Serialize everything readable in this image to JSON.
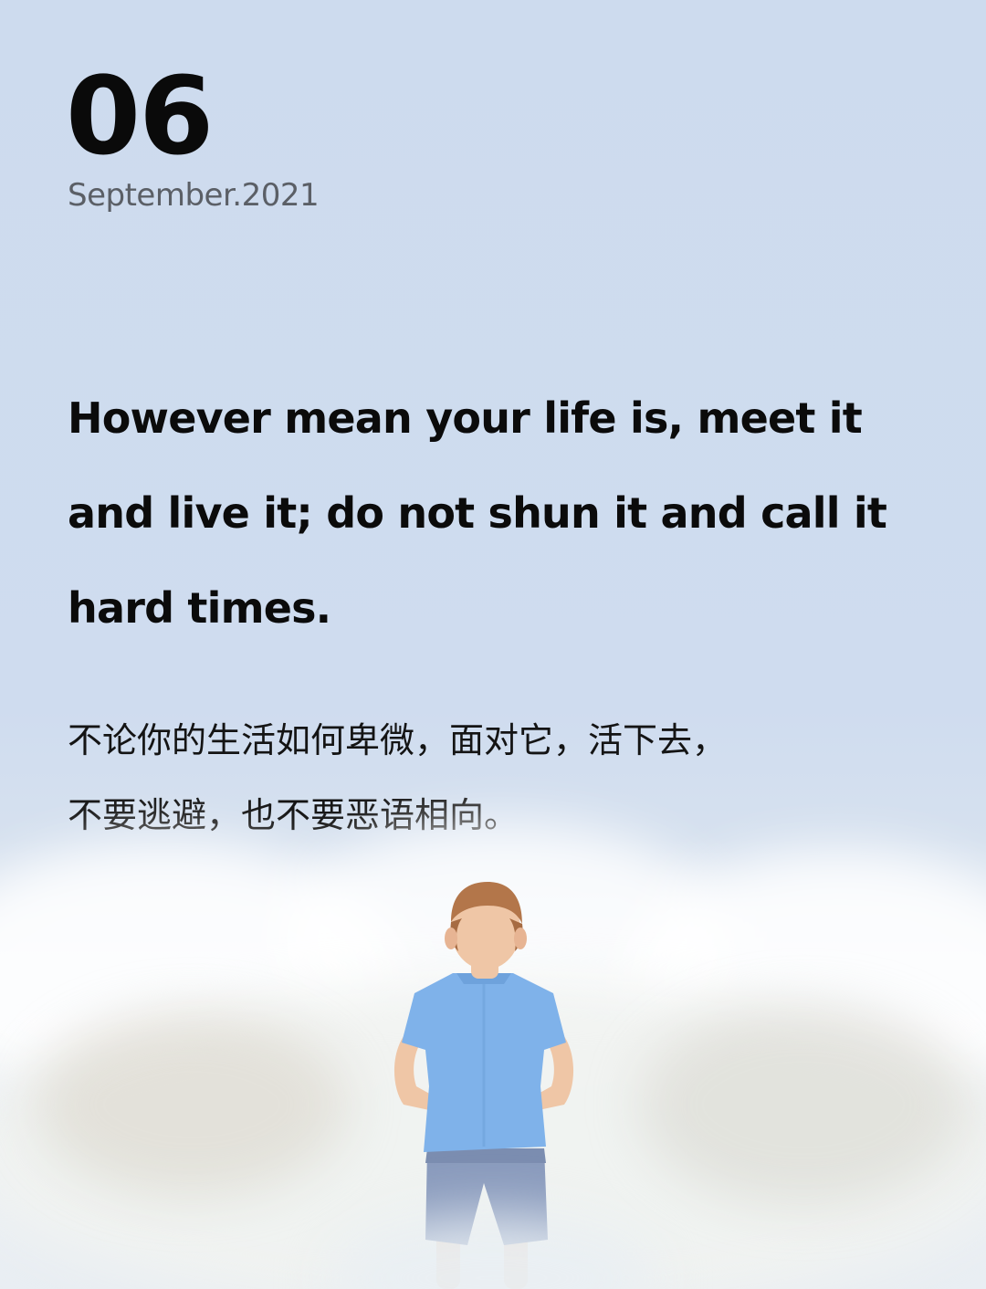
{
  "date": {
    "day": "06",
    "month_year": "September.2021"
  },
  "quote": {
    "english_lines": [
      "However mean your life is, meet it",
      "and live it; do not shun it and call it",
      "hard times."
    ],
    "chinese_lines": [
      "不论你的生活如何卑微，面对它，活下去，",
      "不要逃避，也不要恶语相向。"
    ]
  },
  "photo": {
    "subject": "child-back-view",
    "shirt_color": "#7fb2ea",
    "shorts_color": "#8a9bbd",
    "hair_color": "#b3764a",
    "spray_color": "#ffffff"
  }
}
